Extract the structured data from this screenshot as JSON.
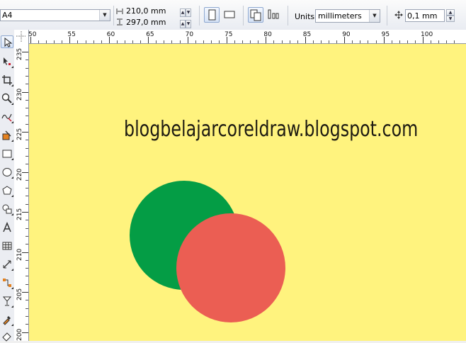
{
  "property_bar": {
    "paper_size": "A4",
    "page_width": "210,0 mm",
    "page_height": "297,0 mm",
    "units_label": "Units:",
    "units_value": "millimeters",
    "nudge": "0,1 mm"
  },
  "toolbox": {
    "tools": [
      "pick-tool",
      "shape-tool",
      "crop-tool",
      "zoom-tool",
      "freehand-tool",
      "smart-fill-tool",
      "rectangle-tool",
      "ellipse-tool",
      "polygon-tool",
      "basic-shapes-tool",
      "text-tool",
      "table-tool",
      "dimension-tool",
      "connector-tool",
      "blend-tool",
      "transparency-tool",
      "eyedropper-tool",
      "fill-tool"
    ]
  },
  "rulers": {
    "horizontal_labels": [
      "50",
      "55",
      "60",
      "65",
      "70",
      "75",
      "80",
      "85",
      "90",
      "95",
      "100"
    ],
    "vertical_labels": [
      "235",
      "230",
      "225",
      "220",
      "215",
      "210",
      "205",
      "200"
    ]
  },
  "canvas": {
    "background_color": "#fff37e",
    "watermark_text": "blogbelajarcoreldraw.blogspot.com",
    "shapes": [
      {
        "name": "green-circle",
        "color": "#049d45"
      },
      {
        "name": "red-circle",
        "color": "#eb5e53"
      }
    ]
  }
}
